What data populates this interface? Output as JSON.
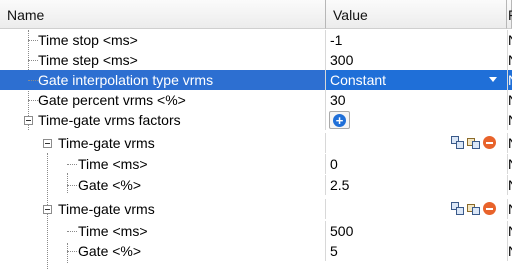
{
  "header": {
    "name": "Name",
    "value": "Value",
    "extra": "F"
  },
  "rows": [
    {
      "name": "Time stop <ms>",
      "value": "-1",
      "extra": "N"
    },
    {
      "name": "Time step <ms>",
      "value": "300",
      "extra": "N"
    },
    {
      "name": "Gate interpolation type vrms",
      "value": "Constant",
      "extra": "N",
      "selected": true
    },
    {
      "name": "Gate percent vrms <%>",
      "value": "30",
      "extra": "N"
    },
    {
      "name": "Time-gate vrms factors",
      "value": "",
      "extra": "N"
    },
    {
      "name": "Time-gate vrms",
      "value": "",
      "extra": "N"
    },
    {
      "name": "Time <ms>",
      "value": "0",
      "extra": "N"
    },
    {
      "name": "Gate <%>",
      "value": "2.5",
      "extra": "N"
    },
    {
      "name": "Time-gate vrms",
      "value": "",
      "extra": "N"
    },
    {
      "name": "Time <ms>",
      "value": "500",
      "extra": "N"
    },
    {
      "name": "Gate <%>",
      "value": "5",
      "extra": "N"
    }
  ],
  "icons": {
    "add": "add-circle-icon",
    "copy": "copy-icon",
    "paste": "paste-icon",
    "remove": "remove-circle-icon",
    "dropdown": "chevron-down-icon"
  },
  "colors": {
    "selection": "#1f6fd8",
    "accent_add": "#1f6fd8",
    "accent_remove": "#e8632b"
  }
}
